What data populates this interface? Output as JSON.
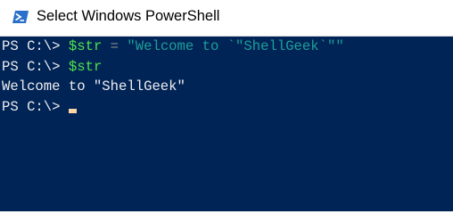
{
  "window": {
    "title": "Select Windows PowerShell",
    "icon": "powershell-icon"
  },
  "colors": {
    "console_background": "#012456",
    "default_text": "#eeedf0",
    "variable": "#4ee44e",
    "operator": "#8a8a8a",
    "string": "#1d9f9a",
    "cursor": "#fed3a5"
  },
  "console": {
    "line1": {
      "prompt": "PS C:\\> ",
      "variable": "$str",
      "operator": " = ",
      "string": "\"Welcome to `\"ShellGeek`\"\""
    },
    "line2": {
      "prompt": "PS C:\\> ",
      "variable": "$str"
    },
    "line3": {
      "output": "Welcome to \"ShellGeek\""
    },
    "line4": {
      "prompt": "PS C:\\> "
    }
  }
}
